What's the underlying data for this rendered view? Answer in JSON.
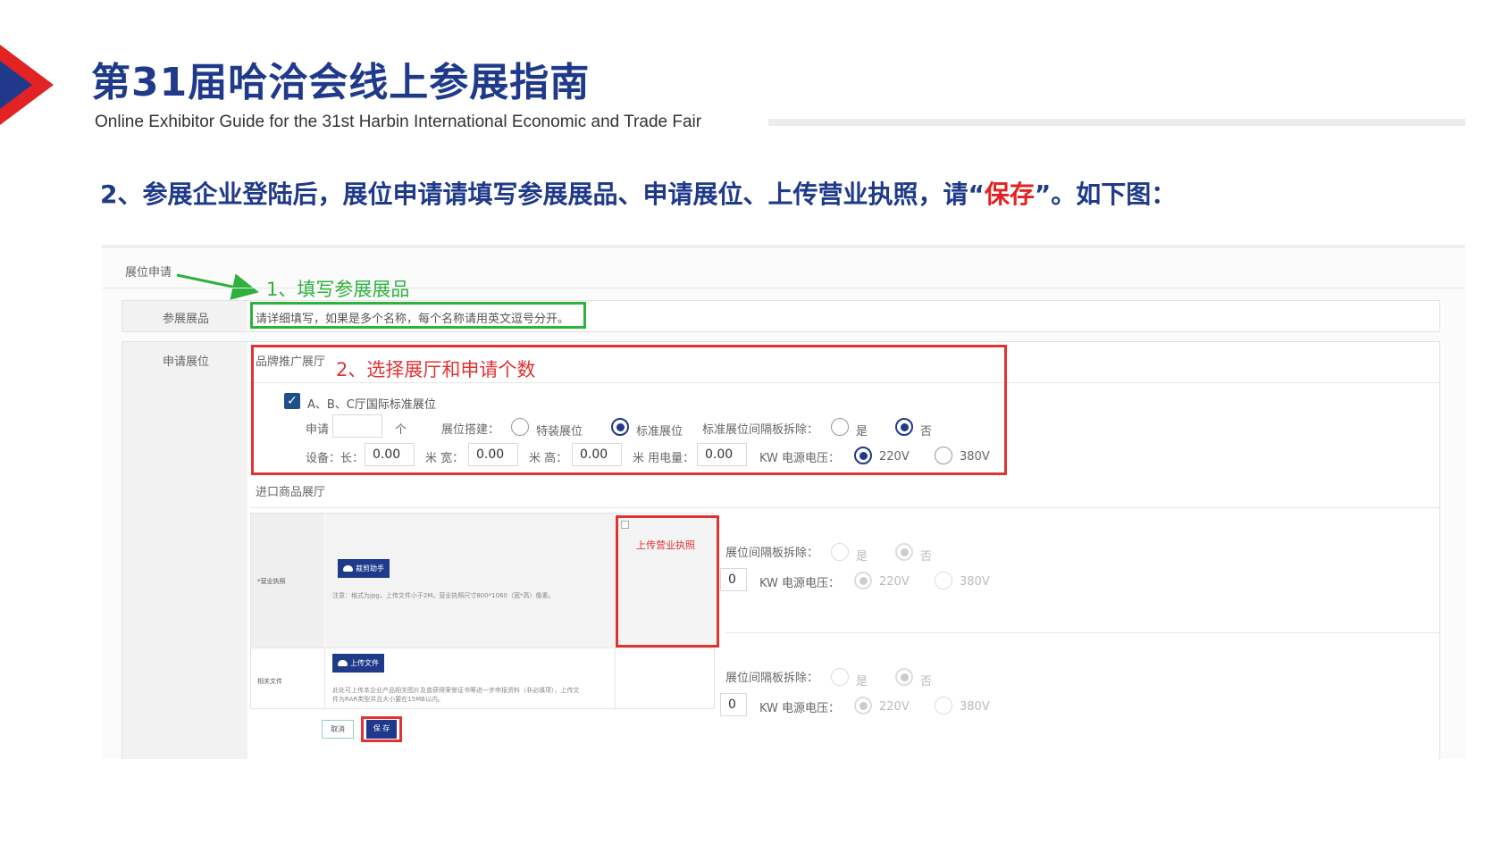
{
  "header": {
    "title": "第31届哈洽会线上参展指南",
    "subtitle": "Online Exhibitor Guide for the 31st Harbin International Economic and Trade Fair",
    "heading_prefix": "2、参展企业登陆后，展位申请请填写参展展品、申请展位、上传营业执照，请“",
    "heading_highlight": "保存",
    "heading_suffix": "”。如下图：",
    "colors": {
      "navy": "#1f3a8a",
      "red": "#e32323"
    }
  },
  "form": {
    "section_title": "展位申请",
    "annotations": {
      "step1": "1、填写参展展品",
      "step2": "2、选择展厅和申请个数"
    },
    "exhibits": {
      "label": "参展展品",
      "placeholder": "请详细填写，如果是多个名称，每个名称请用英文逗号分开。"
    },
    "booth": {
      "label": "申请展位",
      "brand_hall": "品牌推广展厅",
      "checkbox_label": "A、B、C厅国际标准展位",
      "apply_label": "申请",
      "unit": "个",
      "build_label": "展位搭建：",
      "build_options": [
        "特装展位",
        "标准展位"
      ],
      "build_selected": "标准展位",
      "partition_label": "标准展位间隔板拆除：",
      "yes": "是",
      "no": "否",
      "device_label": "设备：长：",
      "length": "0.00",
      "meter_width": "米 宽：",
      "width": "0.00",
      "meter_height": "米 高：",
      "height": "0.00",
      "meter_power": "米 用电量：",
      "power": "0.00",
      "kw_voltage": "KW 电源电压：",
      "v220": "220V",
      "v380": "380V",
      "import_hall": "进口商品展厅"
    },
    "overlay": {
      "license_label": "*营业执照",
      "crop_button": "裁剪助手",
      "license_note": "注意：格式为jpg，上传文件小于2M。营业执照尺寸800*1060（宽*高）像素。",
      "upload_license": "上传营业执照",
      "related_label": "相关文件",
      "upload_file_button": "上传文件",
      "related_note_1": "此处可上传本企业产品相关图片及曾获得荣誉证书等进一步申报资料（非必填项），上传文",
      "related_note_2": "件为RAR类型并且大小要在15MB以内。",
      "partition_label": "展位间隔板拆除：",
      "zero": "0",
      "cancel_button": "取消",
      "save_button": "保 存"
    }
  }
}
